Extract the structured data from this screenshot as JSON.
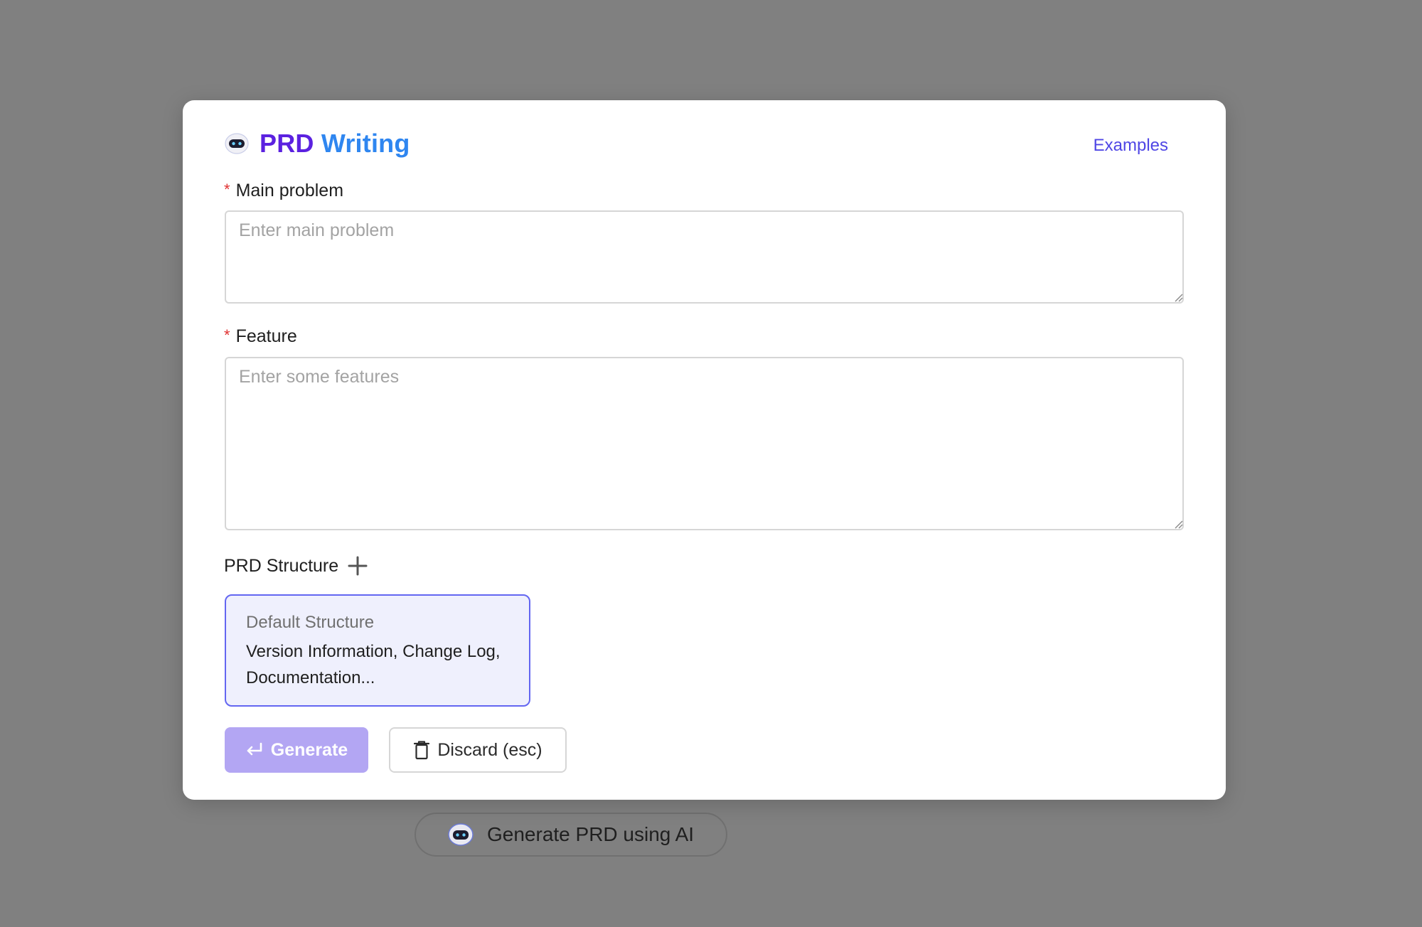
{
  "background": {
    "pill_label": "Generate PRD using AI"
  },
  "modal": {
    "title_part1": "PRD",
    "title_part2": "Writing",
    "examples_link": "Examples",
    "fields": {
      "main_problem": {
        "required_mark": "*",
        "label": "Main problem",
        "placeholder": "Enter main problem",
        "value": ""
      },
      "feature": {
        "required_mark": "*",
        "label": "Feature",
        "placeholder": "Enter some features",
        "value": ""
      }
    },
    "structure": {
      "label": "PRD Structure",
      "cards": [
        {
          "name": "Default Structure",
          "description": "Version Information, Change Log, Documentation..."
        }
      ]
    },
    "buttons": {
      "generate": "Generate",
      "discard": "Discard (esc)"
    }
  },
  "colors": {
    "overlay": "#808080",
    "accent": "#4f46e5",
    "title_purple": "#5b21e0",
    "title_blue": "#2f86f0",
    "required": "#e03131",
    "generate_disabled": "#b3a6f3",
    "card_border": "#6366f1",
    "card_bg": "#eff0fd"
  },
  "icons": [
    "robot-icon",
    "plus-icon",
    "enter-icon",
    "trash-icon",
    "resize-grip-icon"
  ]
}
